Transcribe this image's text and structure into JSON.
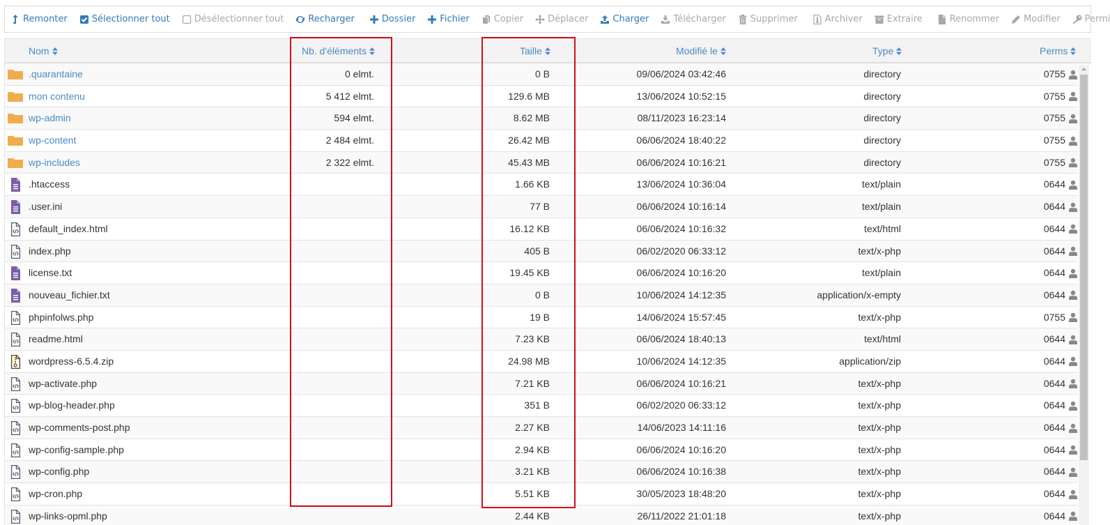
{
  "toolbar": {
    "buttons": [
      {
        "label": "Remonter",
        "icon": "level-up-icon",
        "state": "active"
      },
      {
        "label": "Sélectionner tout",
        "icon": "checkbox-checked-icon",
        "state": "active"
      },
      {
        "label": "Désélectionner tout",
        "icon": "checkbox-empty-icon",
        "state": "disabled"
      },
      {
        "label": "Recharger",
        "icon": "refresh-icon",
        "state": "active"
      },
      {
        "label": "Dossier",
        "icon": "plus-icon",
        "state": "active"
      },
      {
        "label": "Fichier",
        "icon": "plus-icon",
        "state": "active"
      },
      {
        "label": "Copier",
        "icon": "copy-icon",
        "state": "disabled"
      },
      {
        "label": "Déplacer",
        "icon": "move-icon",
        "state": "disabled"
      },
      {
        "label": "Charger",
        "icon": "upload-icon",
        "state": "active"
      },
      {
        "label": "Télécharger",
        "icon": "download-icon",
        "state": "disabled"
      },
      {
        "label": "Supprimer",
        "icon": "trash-icon",
        "state": "disabled"
      },
      {
        "label": "Archiver",
        "icon": "archive-file-icon",
        "state": "disabled"
      },
      {
        "label": "Extraire",
        "icon": "archive-box-icon",
        "state": "disabled"
      },
      {
        "label": "Renommer",
        "icon": "file-icon",
        "state": "disabled"
      },
      {
        "label": "Modifier",
        "icon": "pencil-icon",
        "state": "disabled"
      },
      {
        "label": "Permissions",
        "icon": "key-icon",
        "state": "disabled"
      }
    ]
  },
  "table": {
    "headers": {
      "name": "Nom",
      "items": "Nb. d'éléments",
      "size": "Taille",
      "modified": "Modifié le",
      "type": "Type",
      "perms": "Perms"
    },
    "rows": [
      {
        "kind": "folder",
        "name": ".quarantaine",
        "items": "0 elmt.",
        "size": "0 B",
        "modified": "09/06/2024 03:42:46",
        "type": "directory",
        "perms": "0755"
      },
      {
        "kind": "folder",
        "name": "mon contenu",
        "items": "5 412 elmt.",
        "size": "129.6 MB",
        "modified": "13/06/2024 10:52:15",
        "type": "directory",
        "perms": "0755"
      },
      {
        "kind": "folder",
        "name": "wp-admin",
        "items": "594 elmt.",
        "size": "8.62 MB",
        "modified": "08/11/2023 16:23:14",
        "type": "directory",
        "perms": "0755"
      },
      {
        "kind": "folder",
        "name": "wp-content",
        "items": "2 484 elmt.",
        "size": "26.42 MB",
        "modified": "06/06/2024 18:40:22",
        "type": "directory",
        "perms": "0755"
      },
      {
        "kind": "folder",
        "name": "wp-includes",
        "items": "2 322 elmt.",
        "size": "45.43 MB",
        "modified": "06/06/2024 10:16:21",
        "type": "directory",
        "perms": "0755"
      },
      {
        "kind": "text",
        "name": ".htaccess",
        "items": "",
        "size": "1.66 KB",
        "modified": "13/06/2024 10:36:04",
        "type": "text/plain",
        "perms": "0644"
      },
      {
        "kind": "text",
        "name": ".user.ini",
        "items": "",
        "size": "77 B",
        "modified": "06/06/2024 10:16:14",
        "type": "text/plain",
        "perms": "0644"
      },
      {
        "kind": "code",
        "name": "default_index.html",
        "items": "",
        "size": "16.12 KB",
        "modified": "06/06/2024 10:16:32",
        "type": "text/html",
        "perms": "0644"
      },
      {
        "kind": "code",
        "name": "index.php",
        "items": "",
        "size": "405 B",
        "modified": "06/02/2020 06:33:12",
        "type": "text/x-php",
        "perms": "0644"
      },
      {
        "kind": "text",
        "name": "license.txt",
        "items": "",
        "size": "19.45 KB",
        "modified": "06/06/2024 10:16:20",
        "type": "text/plain",
        "perms": "0644"
      },
      {
        "kind": "text",
        "name": "nouveau_fichier.txt",
        "items": "",
        "size": "0 B",
        "modified": "10/06/2024 14:12:35",
        "type": "application/x-empty",
        "perms": "0644"
      },
      {
        "kind": "code",
        "name": "phpinfolws.php",
        "items": "",
        "size": "19 B",
        "modified": "14/06/2024 15:57:45",
        "type": "text/x-php",
        "perms": "0755"
      },
      {
        "kind": "code",
        "name": "readme.html",
        "items": "",
        "size": "7.23 KB",
        "modified": "06/06/2024 18:40:13",
        "type": "text/html",
        "perms": "0644"
      },
      {
        "kind": "zip",
        "name": "wordpress-6.5.4.zip",
        "items": "",
        "size": "24.98 MB",
        "modified": "10/06/2024 14:12:35",
        "type": "application/zip",
        "perms": "0644"
      },
      {
        "kind": "code",
        "name": "wp-activate.php",
        "items": "",
        "size": "7.21 KB",
        "modified": "06/06/2024 10:16:21",
        "type": "text/x-php",
        "perms": "0644"
      },
      {
        "kind": "code",
        "name": "wp-blog-header.php",
        "items": "",
        "size": "351 B",
        "modified": "06/02/2020 06:33:12",
        "type": "text/x-php",
        "perms": "0644"
      },
      {
        "kind": "code",
        "name": "wp-comments-post.php",
        "items": "",
        "size": "2.27 KB",
        "modified": "14/06/2023 14:11:16",
        "type": "text/x-php",
        "perms": "0644"
      },
      {
        "kind": "code",
        "name": "wp-config-sample.php",
        "items": "",
        "size": "2.94 KB",
        "modified": "06/06/2024 10:16:20",
        "type": "text/x-php",
        "perms": "0644"
      },
      {
        "kind": "code",
        "name": "wp-config.php",
        "items": "",
        "size": "3.21 KB",
        "modified": "06/06/2024 10:16:38",
        "type": "text/x-php",
        "perms": "0644"
      },
      {
        "kind": "code",
        "name": "wp-cron.php",
        "items": "",
        "size": "5.51 KB",
        "modified": "30/05/2023 18:48:20",
        "type": "text/x-php",
        "perms": "0644"
      },
      {
        "kind": "code",
        "name": "wp-links-opml.php",
        "items": "",
        "size": "2.44 KB",
        "modified": "26/11/2022 21:01:18",
        "type": "text/x-php",
        "perms": "0644"
      }
    ]
  },
  "colors": {
    "link": "#4a8ac8",
    "accent": "#337ab7",
    "disabled": "#a8a8a8",
    "folder": "#f0ad4e",
    "text_file": "#7b5ea7",
    "annotation": "#d0101c"
  }
}
